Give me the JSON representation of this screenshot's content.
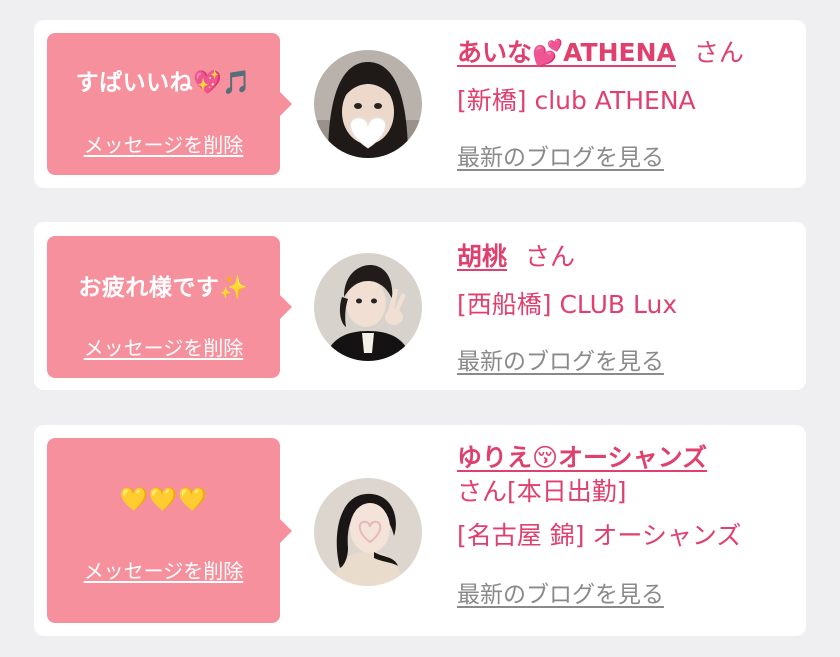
{
  "messages": [
    {
      "text": "すぱいいね💖🎵",
      "delete_label": "メッセージを削除",
      "name": "あいな💕ATHENA",
      "honorific": "さん",
      "status": "",
      "shop": "[新橋] club ATHENA",
      "blog_label": "最新のブログを見る",
      "avatar": "avatar-photo"
    },
    {
      "text": "お疲れ様です✨",
      "delete_label": "メッセージを削除",
      "name": "胡桃",
      "honorific": "さん",
      "status": "",
      "shop": "[西船橋] CLUB Lux",
      "blog_label": "最新のブログを見る",
      "avatar": "avatar-photo"
    },
    {
      "text": "💛💛💛",
      "delete_label": "メッセージを削除",
      "name": "ゆりえ😚オーシャンズ",
      "honorific": "さん",
      "status": "[本日出勤]",
      "shop": "[名古屋 錦] オーシャンズ",
      "blog_label": "最新のブログを見る",
      "avatar": "avatar-photo"
    }
  ],
  "colors": {
    "bubble": "#f6909c",
    "accent": "#e0406e",
    "link_gray": "#8a8a8a",
    "background": "#efeff1"
  }
}
